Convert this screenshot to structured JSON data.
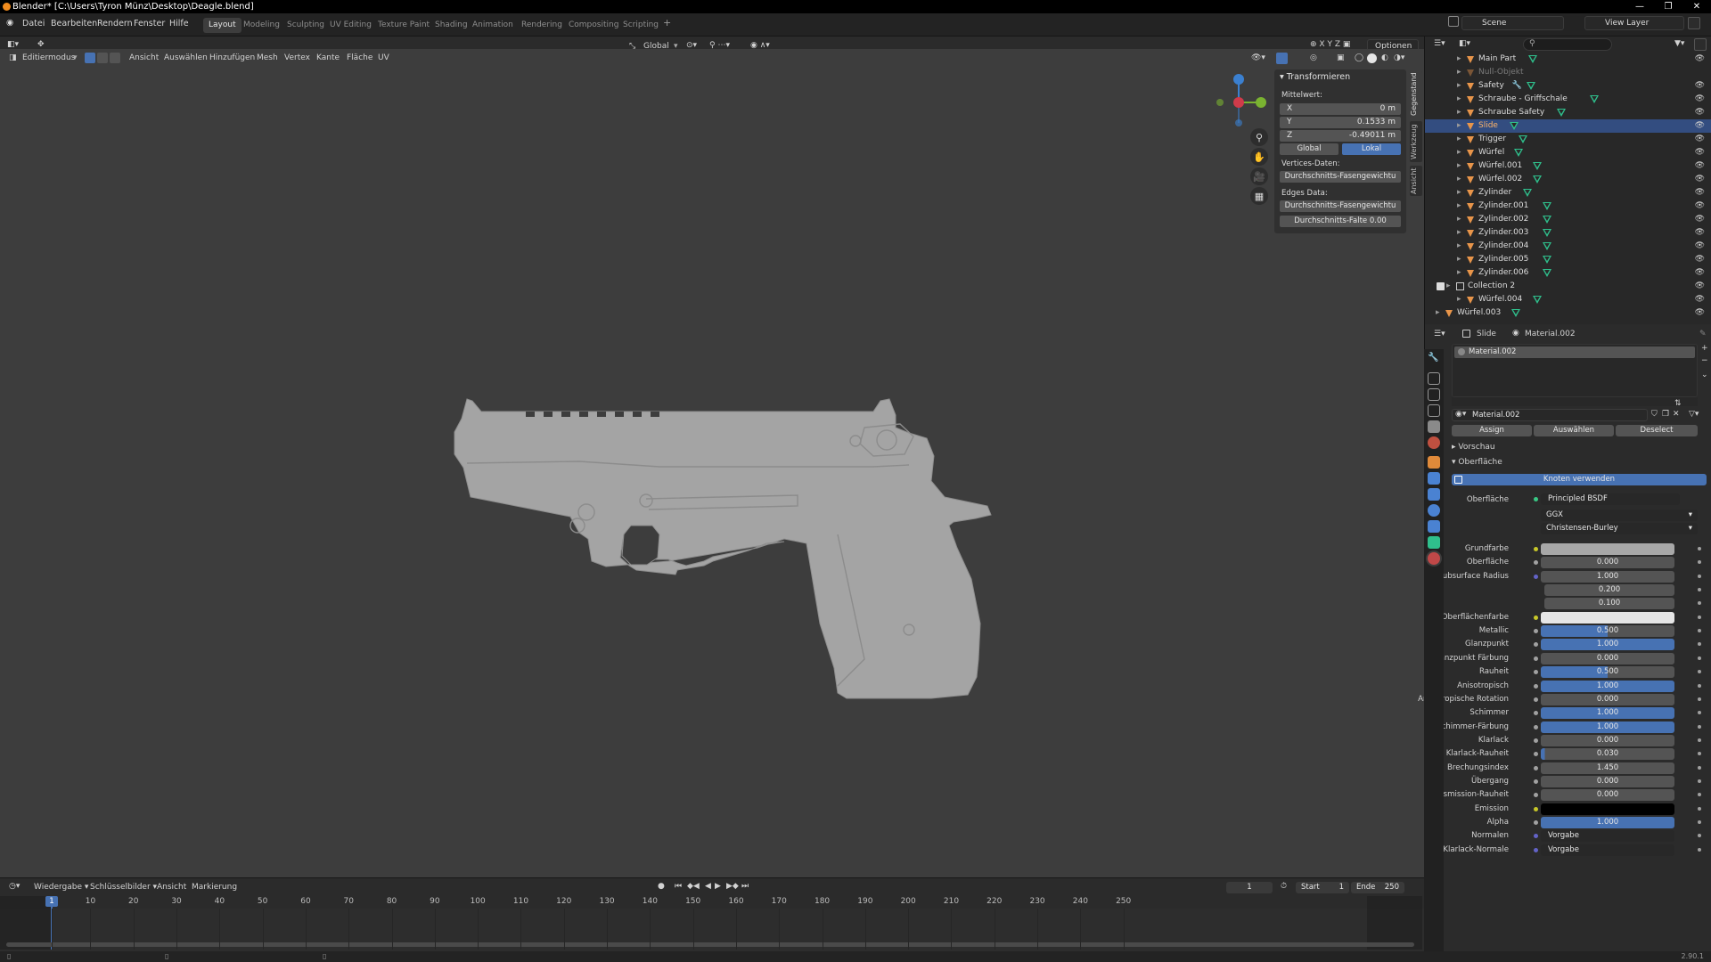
{
  "title_bar": {
    "text": "Blender* [C:\\Users\\Tyron Münz\\Desktop\\Deagle.blend]"
  },
  "menus": [
    "Datei",
    "Bearbeiten",
    "Rendern",
    "Fenster",
    "Hilfe"
  ],
  "workspace_tabs": [
    "Layout",
    "Modeling",
    "Sculpting",
    "UV Editing",
    "Texture Paint",
    "Shading",
    "Animation",
    "Rendering",
    "Compositing",
    "Scripting"
  ],
  "active_workspace": "Layout",
  "scene": {
    "scene_name": "Scene",
    "view_layer": "View Layer"
  },
  "header": {
    "transform_orientation": "Global",
    "options_label": "Optionen",
    "axes": [
      "X",
      "Y",
      "Z"
    ]
  },
  "tool_header": {
    "mode": "Editiermodus",
    "menus": [
      "Ansicht",
      "Auswählen",
      "Hinzufügen",
      "Mesh",
      "Vertex",
      "Kante",
      "Fläche",
      "UV"
    ]
  },
  "n_panel": {
    "section": "Transformieren",
    "median_label": "Mittelwert:",
    "fields": [
      {
        "k": "X",
        "v": "0 m"
      },
      {
        "k": "Y",
        "v": "0.1533 m"
      },
      {
        "k": "Z",
        "v": "-0.49011 m"
      }
    ],
    "toggle": [
      "Global",
      "Lokal"
    ],
    "active_toggle": "Lokal",
    "vertex_data_label": "Vertices-Daten:",
    "vertex_btn": "Durchschnitts-Fasengewichtu",
    "edges_data_label": "Edges Data:",
    "edge_btn1": "Durchschnitts-Fasengewichtu",
    "edge_btn2": "Durchschnitts-Falte 0.00",
    "side_tabs": [
      "Gegenstand",
      "Werkzeug",
      "Ansicht"
    ]
  },
  "outliner": {
    "items": [
      {
        "name": "Main Part",
        "indent": 2,
        "mod": false,
        "sel": false,
        "dim": false
      },
      {
        "name": "Null-Objekt",
        "indent": 2,
        "mod": false,
        "sel": false,
        "dim": true
      },
      {
        "name": "Safety",
        "indent": 2,
        "mod": true,
        "sel": false,
        "dim": false
      },
      {
        "name": "Schraube - Griffschale",
        "indent": 2,
        "mod": false,
        "sel": false,
        "dim": false
      },
      {
        "name": "Schraube Safety",
        "indent": 2,
        "mod": false,
        "sel": false,
        "dim": false
      },
      {
        "name": "Slide",
        "indent": 2,
        "mod": false,
        "sel": true,
        "dim": false
      },
      {
        "name": "Trigger",
        "indent": 2,
        "mod": false,
        "sel": false,
        "dim": false
      },
      {
        "name": "Würfel",
        "indent": 2,
        "mod": false,
        "sel": false,
        "dim": false
      },
      {
        "name": "Würfel.001",
        "indent": 2,
        "mod": false,
        "sel": false,
        "dim": false
      },
      {
        "name": "Würfel.002",
        "indent": 2,
        "mod": false,
        "sel": false,
        "dim": false
      },
      {
        "name": "Zylinder",
        "indent": 2,
        "mod": false,
        "sel": false,
        "dim": false
      },
      {
        "name": "Zylinder.001",
        "indent": 2,
        "mod": false,
        "sel": false,
        "dim": false
      },
      {
        "name": "Zylinder.002",
        "indent": 2,
        "mod": false,
        "sel": false,
        "dim": false
      },
      {
        "name": "Zylinder.003",
        "indent": 2,
        "mod": false,
        "sel": false,
        "dim": false
      },
      {
        "name": "Zylinder.004",
        "indent": 2,
        "mod": false,
        "sel": false,
        "dim": false
      },
      {
        "name": "Zylinder.005",
        "indent": 2,
        "mod": false,
        "sel": false,
        "dim": false
      },
      {
        "name": "Zylinder.006",
        "indent": 2,
        "mod": false,
        "sel": false,
        "dim": false
      },
      {
        "name": "Collection 2",
        "indent": 1,
        "mod": false,
        "sel": false,
        "dim": false,
        "collection": true
      },
      {
        "name": "Würfel.004",
        "indent": 2,
        "mod": false,
        "sel": false,
        "dim": false
      },
      {
        "name": "Würfel.003",
        "indent": 0,
        "mod": false,
        "sel": false,
        "dim": false
      }
    ]
  },
  "properties": {
    "breadcrumb_object": "Slide",
    "breadcrumb_material": "Material.002",
    "slot_name": "Material.002",
    "material_name": "Material.002",
    "buttons": [
      "Assign",
      "Auswählen",
      "Deselect"
    ],
    "preview_label": "Vorschau",
    "surface_label": "Oberfläche",
    "use_nodes_label": "Knoten verwenden",
    "surface_field_label": "Oberfläche",
    "surface_shader": "Principled BSDF",
    "distribution": "GGX",
    "subsurface_method": "Christensen-Burley",
    "rows": [
      {
        "label": "Grundfarbe",
        "value": "",
        "kind": "color",
        "color": "#a8a8a8",
        "socket": "#c7c729"
      },
      {
        "label": "Oberfläche",
        "value": "0.000",
        "kind": "num",
        "socket": "#a1a1a1"
      },
      {
        "label": "Subsurface Radius",
        "value": "1.000",
        "kind": "num",
        "socket": "#6363c7"
      },
      {
        "label": "",
        "value": "0.200",
        "kind": "num",
        "socket": ""
      },
      {
        "label": "",
        "value": "0.100",
        "kind": "num",
        "socket": ""
      },
      {
        "label": "Oberflächenfarbe",
        "value": "",
        "kind": "color",
        "color": "#e6e6e6",
        "socket": "#c7c729"
      },
      {
        "label": "Metallic",
        "value": "0.500",
        "kind": "blue",
        "fill": 0.5,
        "socket": "#a1a1a1"
      },
      {
        "label": "Glanzpunkt",
        "value": "1.000",
        "kind": "blue",
        "fill": 1.0,
        "socket": "#a1a1a1"
      },
      {
        "label": "Glanzpunkt Färbung",
        "value": "0.000",
        "kind": "num",
        "socket": "#a1a1a1"
      },
      {
        "label": "Rauheit",
        "value": "0.500",
        "kind": "blue",
        "fill": 0.5,
        "socket": "#a1a1a1"
      },
      {
        "label": "Anisotropisch",
        "value": "1.000",
        "kind": "blue",
        "fill": 1.0,
        "socket": "#a1a1a1"
      },
      {
        "label": "Anisotropische Rotation",
        "value": "0.000",
        "kind": "num",
        "socket": "#a1a1a1"
      },
      {
        "label": "Schimmer",
        "value": "1.000",
        "kind": "blue",
        "fill": 1.0,
        "socket": "#a1a1a1"
      },
      {
        "label": "Schimmer-Färbung",
        "value": "1.000",
        "kind": "blue",
        "fill": 1.0,
        "socket": "#a1a1a1"
      },
      {
        "label": "Klarlack",
        "value": "0.000",
        "kind": "num",
        "socket": "#a1a1a1"
      },
      {
        "label": "Klarlack-Rauheit",
        "value": "0.030",
        "kind": "blue",
        "fill": 0.03,
        "socket": "#a1a1a1"
      },
      {
        "label": "Brechungsindex",
        "value": "1.450",
        "kind": "num",
        "socket": "#a1a1a1"
      },
      {
        "label": "Übergang",
        "value": "0.000",
        "kind": "num",
        "socket": "#a1a1a1"
      },
      {
        "label": "Transmission-Rauheit",
        "value": "0.000",
        "kind": "num",
        "socket": "#a1a1a1"
      },
      {
        "label": "Emission",
        "value": "",
        "kind": "color",
        "color": "#000000",
        "socket": "#c7c729"
      },
      {
        "label": "Alpha",
        "value": "1.000",
        "kind": "blue",
        "fill": 1.0,
        "socket": "#a1a1a1"
      },
      {
        "label": "Normalen",
        "value": "Vorgabe",
        "kind": "text",
        "socket": "#6363c7"
      },
      {
        "label": "Klarlack-Normale",
        "value": "Vorgabe",
        "kind": "text",
        "socket": "#6363c7"
      }
    ]
  },
  "timeline": {
    "menus": [
      "Wiedergabe",
      "Schlüsselbilder",
      "Ansicht",
      "Markierung"
    ],
    "current_frame": "1",
    "start_label": "Start",
    "start": "1",
    "end_label": "Ende",
    "end": "250",
    "ticks": [
      "1",
      "10",
      "20",
      "30",
      "40",
      "50",
      "60",
      "70",
      "80",
      "90",
      "100",
      "110",
      "120",
      "130",
      "140",
      "150",
      "160",
      "170",
      "180",
      "190",
      "200",
      "210",
      "220",
      "230",
      "240",
      "250"
    ]
  },
  "status": {
    "version": "2.90.1"
  }
}
